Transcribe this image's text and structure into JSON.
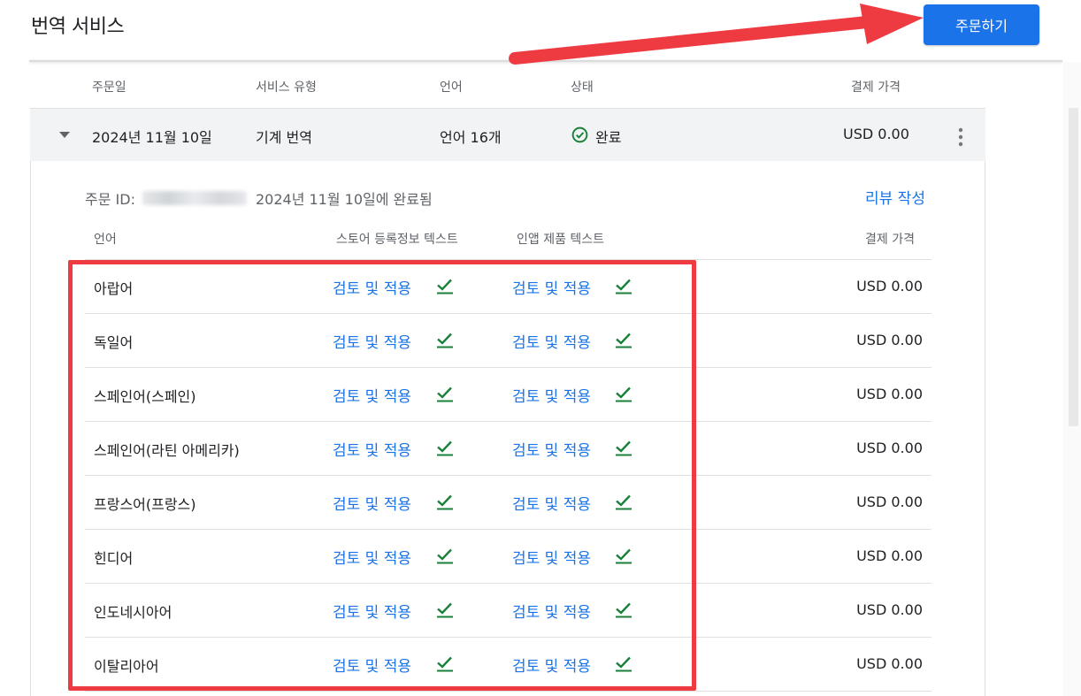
{
  "header": {
    "title": "번역 서비스",
    "order_button": "주문하기"
  },
  "columns": {
    "order_date": "주문일",
    "service_type": "서비스 유형",
    "language": "언어",
    "status": "상태",
    "price": "결제 가격"
  },
  "order": {
    "date": "2024년 11월 10일",
    "service": "기계 번역",
    "languages": "언어 16개",
    "status": "완료",
    "price": "USD 0.00",
    "id_label": "주문 ID:",
    "completed_text": "2024년 11월 10일에 완료됨",
    "review_link": "리뷰 작성"
  },
  "detail_columns": {
    "language": "언어",
    "store_text": "스토어 등록정보 텍스트",
    "inapp_text": "인앱 제품 텍스트",
    "price": "결제 가격"
  },
  "rows": [
    {
      "language": "아랍어",
      "store_action": "검토 및 적용",
      "inapp_action": "검토 및 적용",
      "price": "USD 0.00"
    },
    {
      "language": "독일어",
      "store_action": "검토 및 적용",
      "inapp_action": "검토 및 적용",
      "price": "USD 0.00"
    },
    {
      "language": "스페인어(스페인)",
      "store_action": "검토 및 적용",
      "inapp_action": "검토 및 적용",
      "price": "USD 0.00"
    },
    {
      "language": "스페인어(라틴 아메리카)",
      "store_action": "검토 및 적용",
      "inapp_action": "검토 및 적용",
      "price": "USD 0.00"
    },
    {
      "language": "프랑스어(프랑스)",
      "store_action": "검토 및 적용",
      "inapp_action": "검토 및 적용",
      "price": "USD 0.00"
    },
    {
      "language": "힌디어",
      "store_action": "검토 및 적용",
      "inapp_action": "검토 및 적용",
      "price": "USD 0.00"
    },
    {
      "language": "인도네시아어",
      "store_action": "검토 및 적용",
      "inapp_action": "검토 및 적용",
      "price": "USD 0.00"
    },
    {
      "language": "이탈리아어",
      "store_action": "검토 및 적용",
      "inapp_action": "검토 및 적용",
      "price": "USD 0.00"
    }
  ],
  "icons": {
    "expand": "arrow-drop-down-icon",
    "status": "check-circle-icon",
    "more": "more-vert-icon",
    "applied": "check-underline-icon"
  },
  "colors": {
    "accent": "#1a73e8",
    "success": "#188038",
    "highlight": "#ee3b41"
  }
}
